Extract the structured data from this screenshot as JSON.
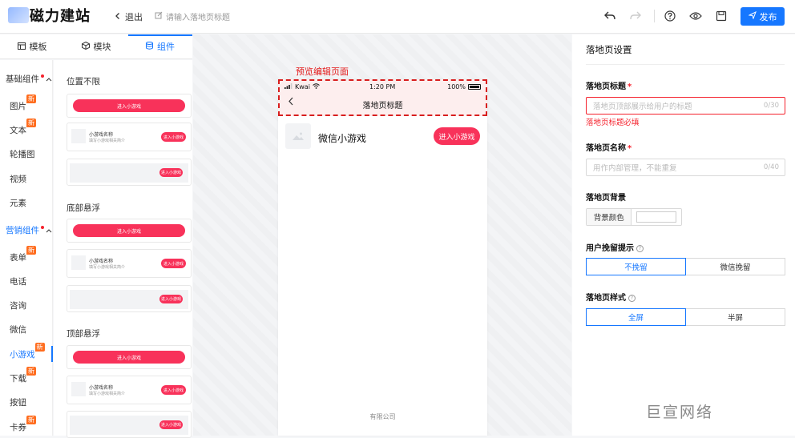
{
  "header": {
    "app_name": "磁力建站",
    "back_label": "退出",
    "title_placeholder": "请输入落地页标题",
    "publish_label": "发布"
  },
  "left_tabs": [
    {
      "label": "模板",
      "icon": "template-icon"
    },
    {
      "label": "模块",
      "icon": "cube-icon"
    },
    {
      "label": "组件",
      "icon": "database-icon",
      "active": true
    }
  ],
  "categories": {
    "basic_group": "基础组件",
    "basic_items": [
      {
        "label": "图片",
        "new": true
      },
      {
        "label": "文本",
        "new": true
      },
      {
        "label": "轮播图",
        "new": false
      },
      {
        "label": "视频",
        "new": false
      },
      {
        "label": "元素",
        "new": false
      }
    ],
    "marketing_group": "营销组件",
    "marketing_items": [
      {
        "label": "表单",
        "new": true
      },
      {
        "label": "电话",
        "new": false
      },
      {
        "label": "咨询",
        "new": false
      },
      {
        "label": "微信",
        "new": false
      },
      {
        "label": "小游戏",
        "new": true,
        "active": true
      },
      {
        "label": "下载",
        "new": true
      },
      {
        "label": "按钮",
        "new": false
      },
      {
        "label": "卡券",
        "new": true
      }
    ],
    "new_badge": "新"
  },
  "components": {
    "sections": [
      {
        "title": "位置不限"
      },
      {
        "title": "底部悬浮"
      },
      {
        "title": "顶部悬浮"
      }
    ],
    "pill_label": "进入小游戏",
    "mini_name": "小游戏名称",
    "mini_sub": "填写小游戏相关简介",
    "mini_btn": "进入小游戏"
  },
  "preview": {
    "label": "预览编辑页面",
    "carrier": "Kwai",
    "time": "1:20 PM",
    "battery": "100%",
    "nav_title": "落地页标题",
    "game_name": "微信小游戏",
    "game_button": "进入小游戏",
    "footer": "有限公司"
  },
  "settings": {
    "title": "落地页设置",
    "page_title_label": "落地页标题",
    "page_title_placeholder": "落地页顶部展示给用户的标题",
    "page_title_counter": "0/30",
    "page_title_error": "落地页标题必填",
    "page_name_label": "落地页名称",
    "page_name_placeholder": "用作内部管理，不能重复",
    "page_name_counter": "0/40",
    "bg_label": "落地页背景",
    "bg_color_label": "背景颜色",
    "retain_label": "用户挽留提示",
    "retain_options": [
      "不挽留",
      "微信挽留"
    ],
    "style_label": "落地页样式",
    "style_options": [
      "全屏",
      "半屏"
    ]
  },
  "watermark": "巨宣网络",
  "colors": {
    "accent": "#1677ff",
    "brand_pink": "#f8325a",
    "error": "#f5222d",
    "badge": "#ff6d1f"
  }
}
